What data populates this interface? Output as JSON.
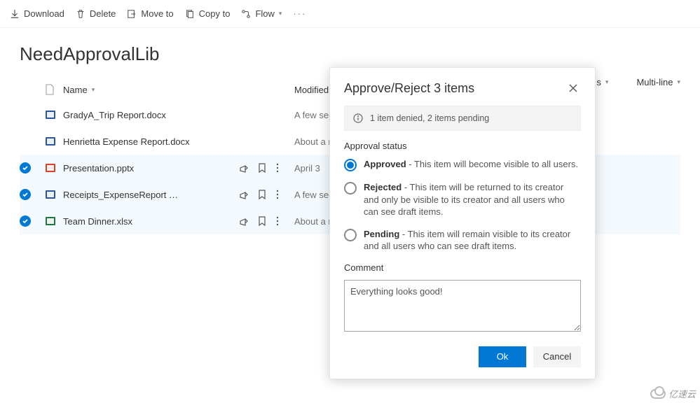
{
  "toolbar": {
    "download": "Download",
    "delete": "Delete",
    "moveto": "Move to",
    "copyto": "Copy to",
    "flow": "Flow"
  },
  "page": {
    "title": "NeedApprovalLib"
  },
  "columns": {
    "name": "Name",
    "modified": "Modified",
    "status": "s",
    "multiline": "Multi-line"
  },
  "files": [
    {
      "name": "GradyA_Trip Report.docx",
      "modified": "A few seconds ago",
      "selected": false,
      "type": "docx"
    },
    {
      "name": "Henrietta Expense Report.docx",
      "modified": "About a minute ago",
      "selected": false,
      "type": "docx"
    },
    {
      "name": "Presentation.pptx",
      "modified": "April 3",
      "selected": true,
      "type": "pptx"
    },
    {
      "name": "Receipts_ExpenseReport …",
      "modified": "A few seconds ago",
      "selected": true,
      "type": "docx"
    },
    {
      "name": "Team Dinner.xlsx",
      "modified": "About a minute ago",
      "selected": true,
      "type": "xlsx"
    }
  ],
  "dialog": {
    "title": "Approve/Reject 3 items",
    "banner": "1 item denied, 2 items pending",
    "section": "Approval status",
    "options": {
      "approved": {
        "label": "Approved",
        "desc": " - This item will become visible to all users."
      },
      "rejected": {
        "label": "Rejected",
        "desc": " - This item will be returned to its creator and only be visible to its creator and all users who can see draft items."
      },
      "pending": {
        "label": "Pending",
        "desc": " - This item will remain visible to its creator and all users who can see draft items."
      }
    },
    "comment_label": "Comment",
    "comment_value": "Everything looks good!",
    "ok": "Ok",
    "cancel": "Cancel"
  },
  "watermark": "亿速云"
}
